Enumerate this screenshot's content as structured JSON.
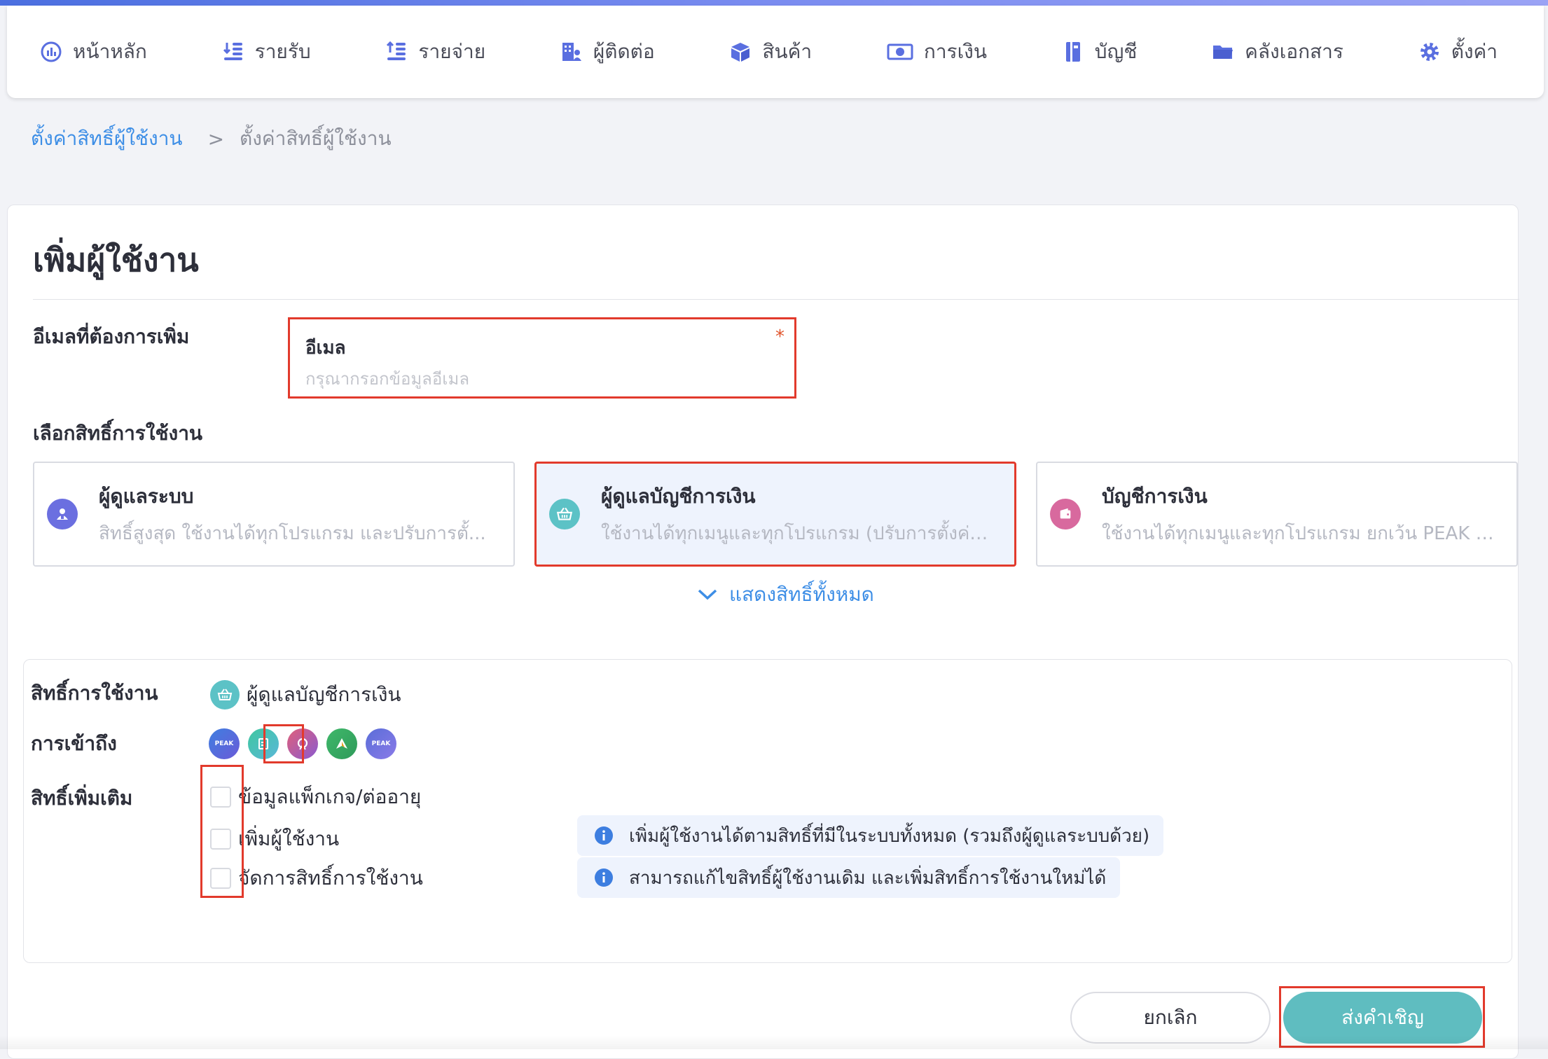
{
  "nav": {
    "items": [
      {
        "label": "หน้าหลัก",
        "icon": "dashboard-icon"
      },
      {
        "label": "รายรับ",
        "icon": "income-icon"
      },
      {
        "label": "รายจ่าย",
        "icon": "expense-icon"
      },
      {
        "label": "ผู้ติดต่อ",
        "icon": "contacts-icon"
      },
      {
        "label": "สินค้า",
        "icon": "product-box-icon"
      },
      {
        "label": "การเงิน",
        "icon": "money-icon"
      },
      {
        "label": "บัญชี",
        "icon": "accounting-book-icon"
      },
      {
        "label": "คลังเอกสาร",
        "icon": "folder-icon"
      },
      {
        "label": "ตั้งค่า",
        "icon": "gear-icon"
      }
    ]
  },
  "breadcrumb": {
    "parent": "ตั้งค่าสิทธิ์ผู้ใช้งาน",
    "separator": ">",
    "current": "ตั้งค่าสิทธิ์ผู้ใช้งาน"
  },
  "form": {
    "title": "เพิ่มผู้ใช้งาน",
    "email_section_label": "อีเมลที่ต้องการเพิ่ม",
    "email": {
      "label": "อีเมล",
      "required_mark": "*",
      "value": "",
      "placeholder": "กรุณากรอกข้อมูลอีเมล"
    },
    "role_section_label": "เลือกสิทธิ์การใช้งาน",
    "roles": [
      {
        "name": "ผู้ดูแลระบบ",
        "desc": "สิทธิ์สูงสุด ใช้งานได้ทุกโปรแกรม และปรับการตั้...",
        "icon": "admin-user-icon",
        "color": "#6b6fe0",
        "selected": false
      },
      {
        "name": "ผู้ดูแลบัญชีการเงิน",
        "desc": "ใช้งานได้ทุกเมนูและทุกโปรแกรม (ปรับการตั้งค่า...",
        "icon": "basket-icon",
        "color": "#5cc2c6",
        "selected": true
      },
      {
        "name": "บัญชีการเงิน",
        "desc": "ใช้งานได้ทุกเมนูและทุกโปรแกรม ยกเว้น PEAK P...",
        "icon": "wallet-icon",
        "color": "#d8699e",
        "selected": false
      }
    ],
    "show_all_label": "แสดงสิทธิ์ทั้งหมด"
  },
  "permissions": {
    "role_label": "สิทธิ์การใช้งาน",
    "role_value": "ผู้ดูแลบัญชีการเงิน",
    "access_label": "การเข้าถึง",
    "apps": [
      {
        "name": "peak-app-icon",
        "text": "PEAK",
        "color": "#4f6ad8"
      },
      {
        "name": "receipt-app-icon",
        "text": "",
        "color": "#4cc4a8"
      },
      {
        "name": "payroll-app-icon",
        "text": "",
        "color": "#c85f8a"
      },
      {
        "name": "asset-app-icon",
        "text": "",
        "color": "#3fb86a"
      },
      {
        "name": "peak-plus-app-icon",
        "text": "PEAK",
        "color": "#5a6ed8"
      }
    ],
    "extra_label": "สิทธิ์เพิ่มเติม",
    "extras": [
      {
        "label": "ข้อมูลแพ็กเกจ/ต่ออายุ",
        "checked": false
      },
      {
        "label": "เพิ่มผู้ใช้งาน",
        "checked": false,
        "info": "เพิ่มผู้ใช้งานได้ตามสิทธิ์ที่มีในระบบทั้งหมด (รวมถึงผู้ดูแลระบบด้วย)"
      },
      {
        "label": "จัดการสิทธิ์การใช้งาน",
        "checked": false,
        "info": "สามารถแก้ไขสิทธิ์ผู้ใช้งานเดิม และเพิ่มสิทธิ์การใช้งานใหม่ได้"
      }
    ]
  },
  "actions": {
    "cancel": "ยกเลิก",
    "send": "ส่งคำเชิญ"
  },
  "colors": {
    "accent_blue": "#3d8ee6",
    "send_button": "#5fbdc0",
    "highlight_red": "#e23a2c",
    "nav_icon": "#5a6fe0"
  }
}
